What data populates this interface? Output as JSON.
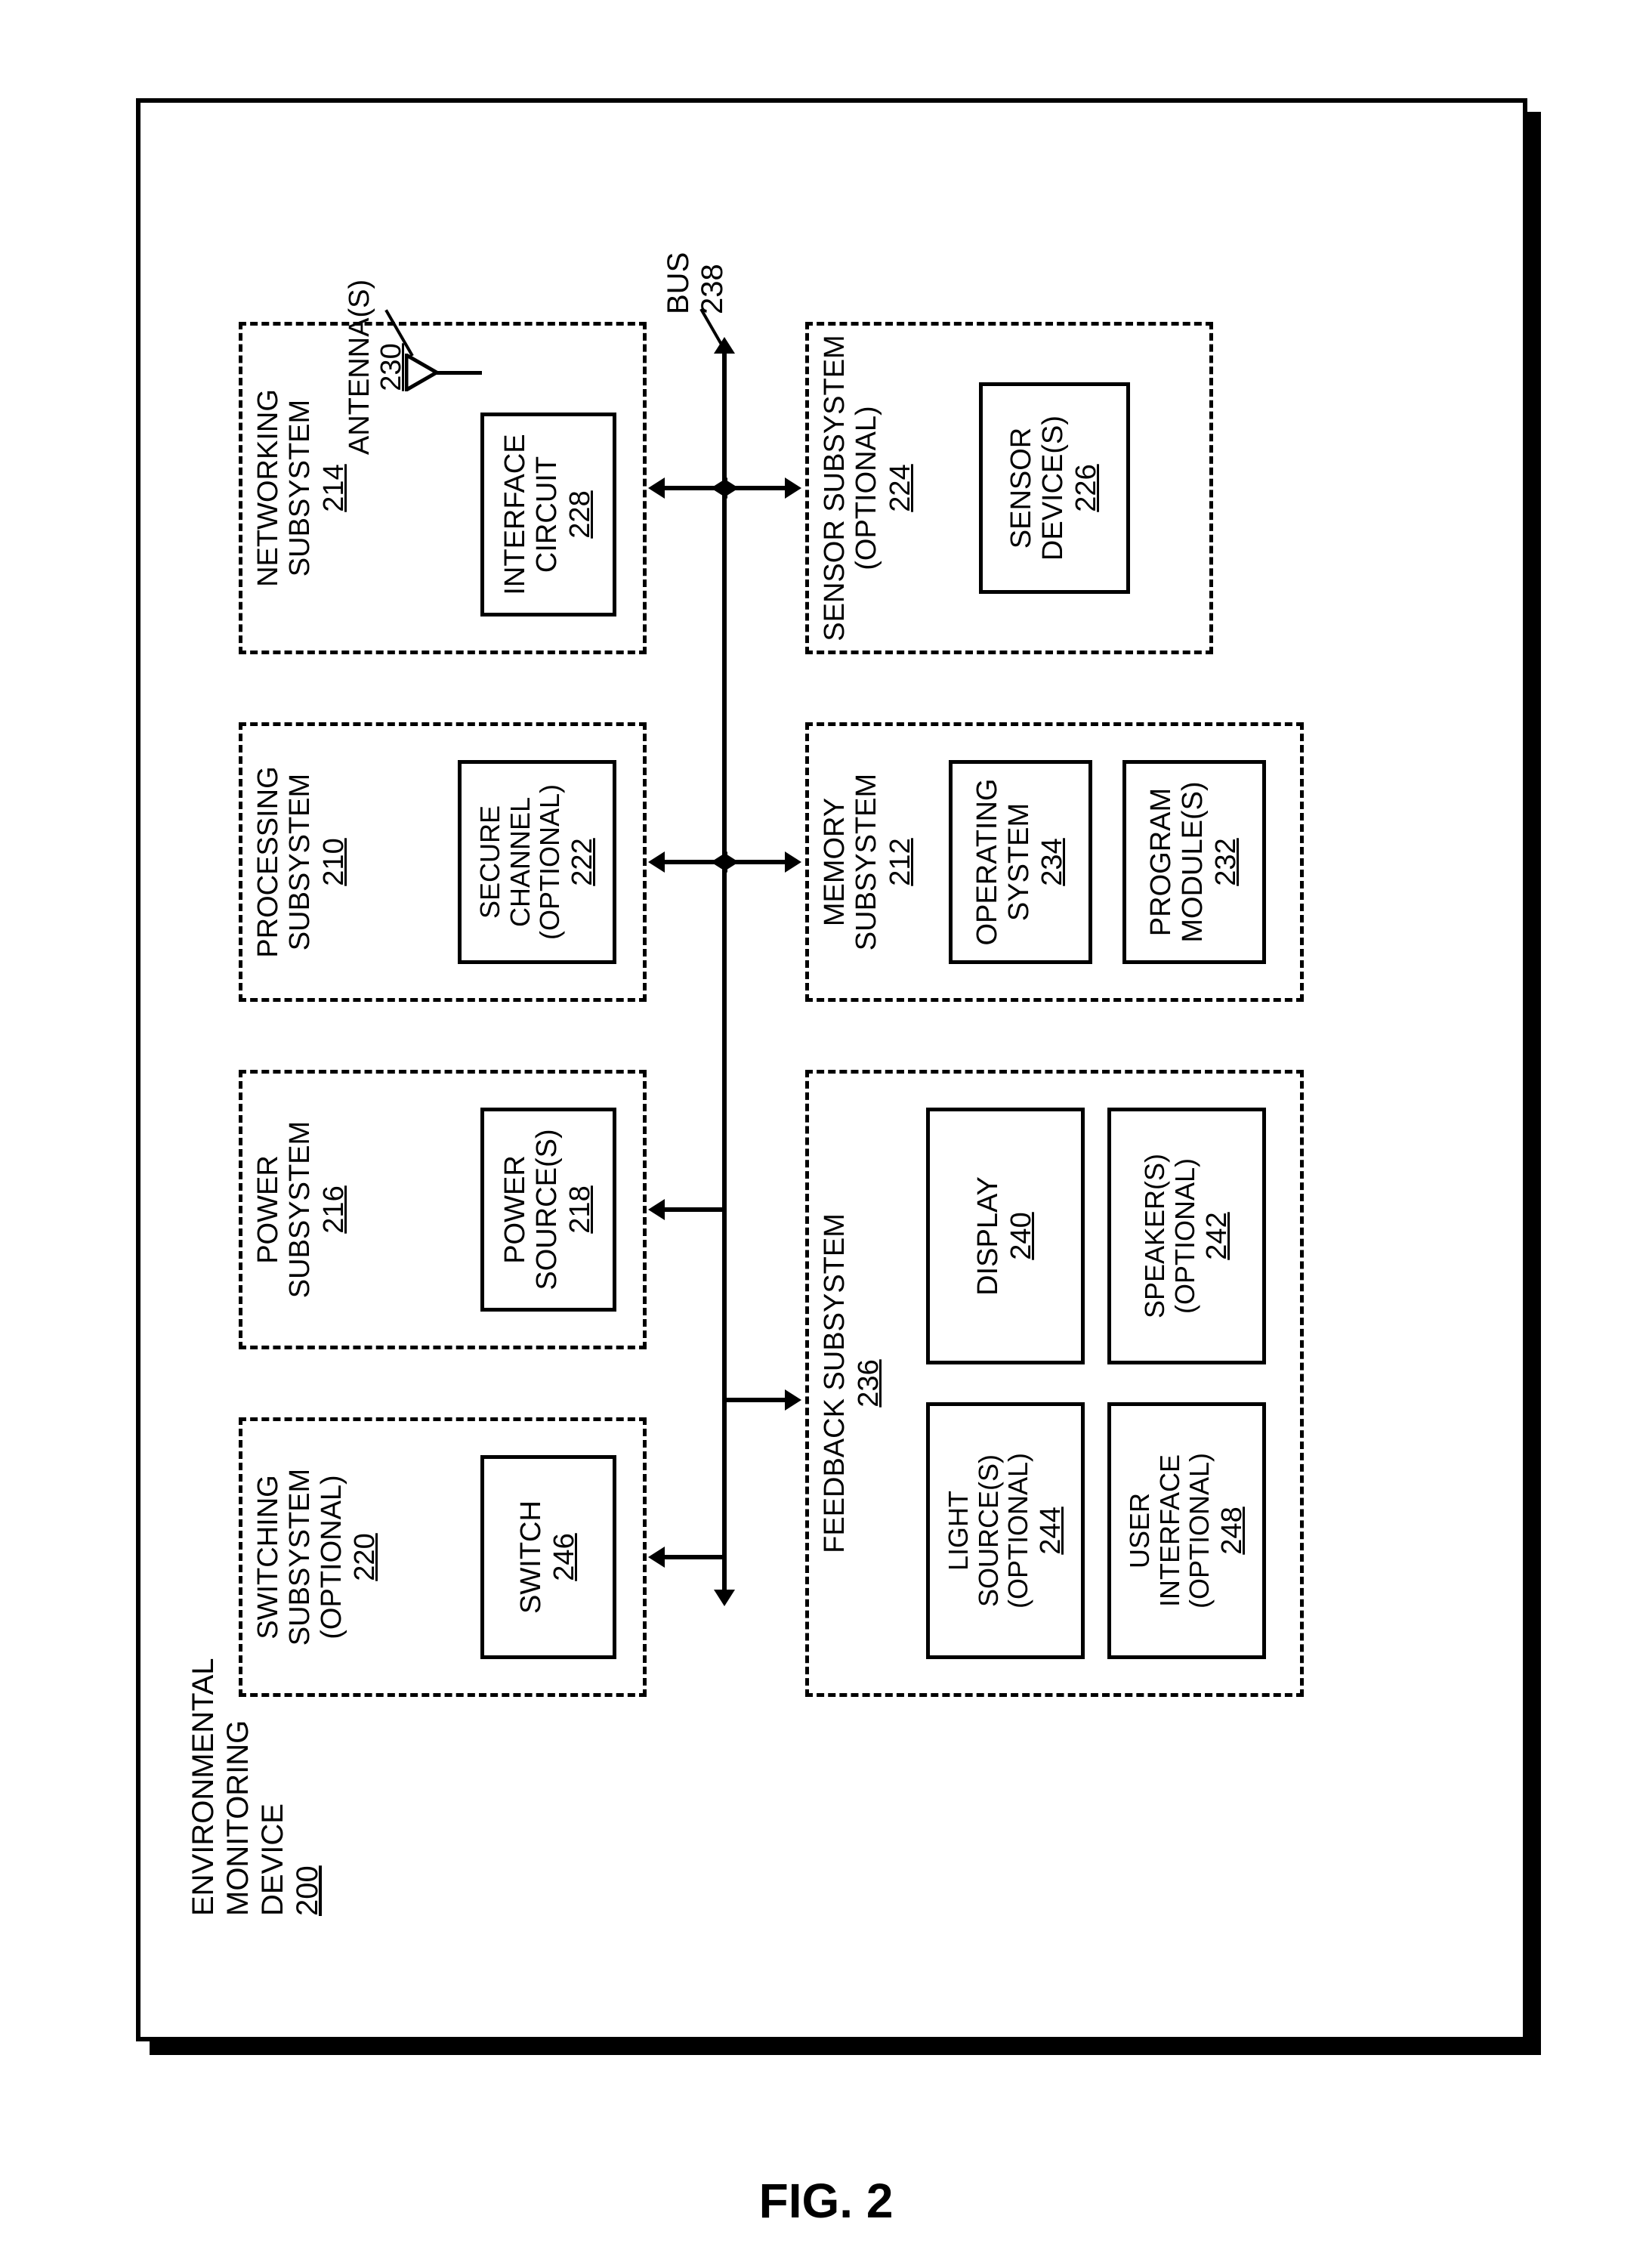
{
  "figure_label": "FIG. 2",
  "device": {
    "label": "ENVIRONMENTAL\nMONITORING\nDEVICE",
    "ref": "200"
  },
  "bus": {
    "label": "BUS",
    "ref": "238"
  },
  "antenna": {
    "label": "ANTENNA(S)",
    "ref": "230"
  },
  "subsystems": {
    "switching": {
      "label": "SWITCHING\nSUBSYSTEM\n(OPTIONAL)",
      "ref": "220",
      "inner": {
        "label": "SWITCH",
        "ref": "246"
      }
    },
    "power": {
      "label": "POWER\nSUBSYSTEM",
      "ref": "216",
      "inner": {
        "label": "POWER\nSOURCE(S)",
        "ref": "218"
      }
    },
    "processing": {
      "label": "PROCESSING\nSUBSYSTEM",
      "ref": "210",
      "inner": {
        "label": "SECURE\nCHANNEL\n(OPTIONAL)",
        "ref": "222"
      }
    },
    "networking": {
      "label": "NETWORKING\nSUBSYSTEM",
      "ref": "214",
      "inner": {
        "label": "INTERFACE\nCIRCUIT",
        "ref": "228"
      }
    },
    "feedback": {
      "label": "FEEDBACK SUBSYSTEM",
      "ref": "236",
      "inner": [
        {
          "label": "LIGHT\nSOURCE(S)\n(OPTIONAL)",
          "ref": "244"
        },
        {
          "label": "DISPLAY",
          "ref": "240"
        },
        {
          "label": "USER\nINTERFACE\n(OPTIONAL)",
          "ref": "248"
        },
        {
          "label": "SPEAKER(S)\n(OPTIONAL)",
          "ref": "242"
        }
      ]
    },
    "memory": {
      "label": "MEMORY\nSUBSYSTEM",
      "ref": "212",
      "inner": [
        {
          "label": "OPERATING\nSYSTEM",
          "ref": "234"
        },
        {
          "label": "PROGRAM\nMODULE(S)",
          "ref": "232"
        }
      ]
    },
    "sensor": {
      "label": "SENSOR SUBSYSTEM\n(OPTIONAL)",
      "ref": "224",
      "inner": {
        "label": "SENSOR\nDEVICE(S)",
        "ref": "226"
      }
    }
  }
}
